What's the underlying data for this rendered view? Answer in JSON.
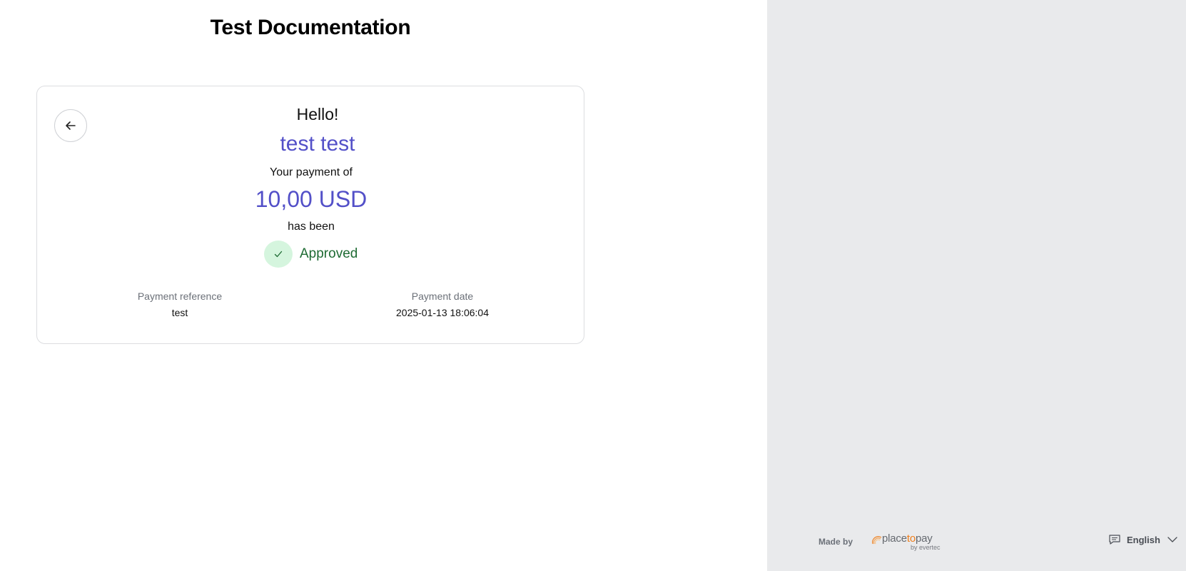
{
  "page": {
    "title": "Test Documentation"
  },
  "result": {
    "greeting": "Hello!",
    "customer_name": "test test",
    "payment_of_label": "Your payment of",
    "amount": "10,00 USD",
    "has_been_label": "has been",
    "status": "Approved",
    "status_icon": "check-icon",
    "back_icon": "arrow-left-icon"
  },
  "details": {
    "reference_label": "Payment reference",
    "reference_value": "test",
    "date_label": "Payment date",
    "date_value": "2025-01-13 18:06:04"
  },
  "footer": {
    "made_by": "Made by",
    "brand": "placetopay",
    "brand_sub": "by evertec",
    "language": "English",
    "language_icon": "chat-icon",
    "dropdown_icon": "chevron-down-icon"
  },
  "colors": {
    "accent": "#5350c8",
    "approved_text": "#1e6b33",
    "approved_bg": "#d5f5de",
    "side_panel": "#e9eaec",
    "brand_orange": "#ef7d1a"
  }
}
